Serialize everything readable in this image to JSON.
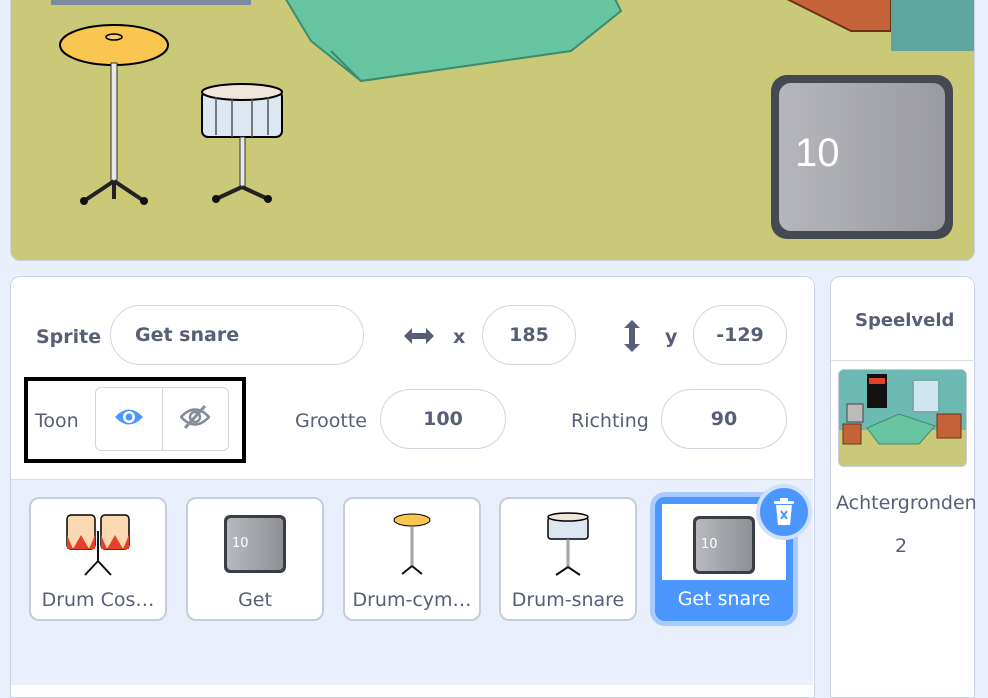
{
  "stage": {
    "variable_display_value": "10"
  },
  "sprite_info": {
    "sprite_label": "Sprite",
    "sprite_name": "Get snare",
    "x_label": "x",
    "x_value": "185",
    "y_label": "y",
    "y_value": "-129",
    "show_label": "Toon",
    "size_label": "Grootte",
    "size_value": "100",
    "direction_label": "Richting",
    "direction_value": "90"
  },
  "sprites": [
    {
      "name": "Drum Cos…",
      "icon": "conga-drum-icon"
    },
    {
      "name": "Get",
      "icon": "number-button-icon",
      "badge": "10"
    },
    {
      "name": "Drum-cym…",
      "icon": "cymbal-icon"
    },
    {
      "name": "Drum-snare",
      "icon": "snare-drum-icon"
    },
    {
      "name": "Get snare",
      "icon": "number-button-icon",
      "badge": "10",
      "selected": true
    }
  ],
  "stage_panel": {
    "title": "Speelveld",
    "backdrops_label": "Achtergronden",
    "backdrops_count": "2"
  },
  "colors": {
    "accent": "#4c97ff",
    "text": "#575e75",
    "background": "#e9f0fb"
  }
}
